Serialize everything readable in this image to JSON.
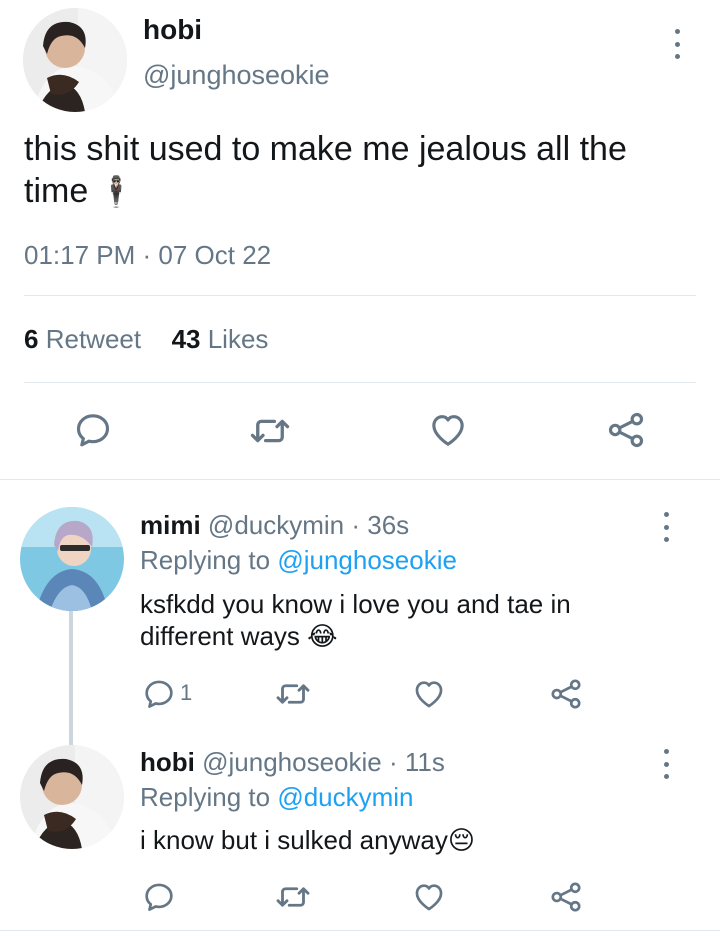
{
  "tweet": {
    "display_name": "hobi",
    "handle": "@junghoseokie",
    "text": "this shit used to make me jealous all the time",
    "text_emoji": "🕴🏻",
    "timestamp": "01:17 PM · 07 Oct 22",
    "retweet_count": "6",
    "retweet_label": "Retweet",
    "like_count": "43",
    "like_label": "Likes"
  },
  "replies": [
    {
      "display_name": "mimi",
      "handle": "@duckymin",
      "time": "· 36s",
      "replying_label": "Replying to",
      "replying_to": "@junghoseokie",
      "text": "ksfkdd you know i love you and tae in different ways",
      "emoji": "😂",
      "reply_count": "1"
    },
    {
      "display_name": "hobi",
      "handle": "@junghoseokie",
      "time": "· 11s",
      "replying_label": "Replying to",
      "replying_to": "@duckymin",
      "text": "i know but i sulked anyway",
      "emoji": "😔",
      "reply_count": ""
    }
  ],
  "icons": [
    "reply-icon",
    "retweet-icon",
    "like-icon",
    "share-icon",
    "more-icon"
  ],
  "colors": {
    "accent": "#1da1f2",
    "muted": "#657786",
    "divider": "#e1e8ed",
    "text": "#14171a"
  }
}
